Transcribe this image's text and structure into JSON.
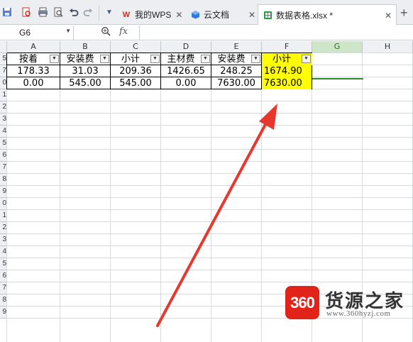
{
  "titlebar": {
    "tabs": [
      {
        "icon": "wps-logo-icon",
        "label": "我的WPS",
        "close": "✕"
      },
      {
        "icon": "cloud-doc-icon",
        "label": "云文档",
        "close": "✕"
      },
      {
        "icon": "spreadsheet-file-icon",
        "label": "数据表格.xlsx *",
        "close": "✕",
        "active": true
      }
    ],
    "new_tab": "+"
  },
  "formula_bar": {
    "name_box": "G6",
    "fx": "fx",
    "formula": ""
  },
  "sheet": {
    "columns": [
      "A",
      "B",
      "C",
      "D",
      "E",
      "F",
      "G",
      "H"
    ],
    "selected_column": "G",
    "row_numbers": [
      "5",
      "7",
      "0",
      "1",
      "2",
      "3",
      "4",
      "5",
      "6",
      "7",
      "8",
      "9",
      "0",
      "1",
      "2",
      "3",
      "4",
      "5",
      "6",
      "7",
      "8",
      "9"
    ],
    "header_row": [
      "按着",
      "安装费",
      "小计",
      "主材费",
      "安装费",
      "小计"
    ],
    "rows": [
      [
        "178.33",
        "31.03",
        "209.36",
        "1426.65",
        "248.25",
        "1674.90"
      ],
      [
        "0.00",
        "545.00",
        "545.00",
        "0.00",
        "7630.00",
        "7630.00"
      ]
    ],
    "highlight_color": "#ffff00",
    "filter_active_column": "F"
  },
  "annotation": {
    "arrow_color": "#e8382e"
  },
  "watermark": {
    "badge": "360",
    "title": "货源之家",
    "url": "www.360hyzj.com"
  }
}
